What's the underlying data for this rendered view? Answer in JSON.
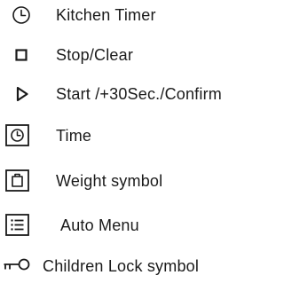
{
  "legend": {
    "items": [
      {
        "icon": "clock-icon",
        "label": "Kitchen Timer"
      },
      {
        "icon": "stop-square-icon",
        "label": "Stop/Clear"
      },
      {
        "icon": "play-triangle-icon",
        "label": "Start /+30Sec./Confirm"
      },
      {
        "icon": "time-box-icon",
        "label": "Time"
      },
      {
        "icon": "weight-box-icon",
        "label": "Weight symbol"
      },
      {
        "icon": "menu-list-box-icon",
        "label": "Auto Menu"
      },
      {
        "icon": "key-lock-icon",
        "label": "Children Lock symbol"
      }
    ],
    "text_color": "#1a1a1a"
  }
}
